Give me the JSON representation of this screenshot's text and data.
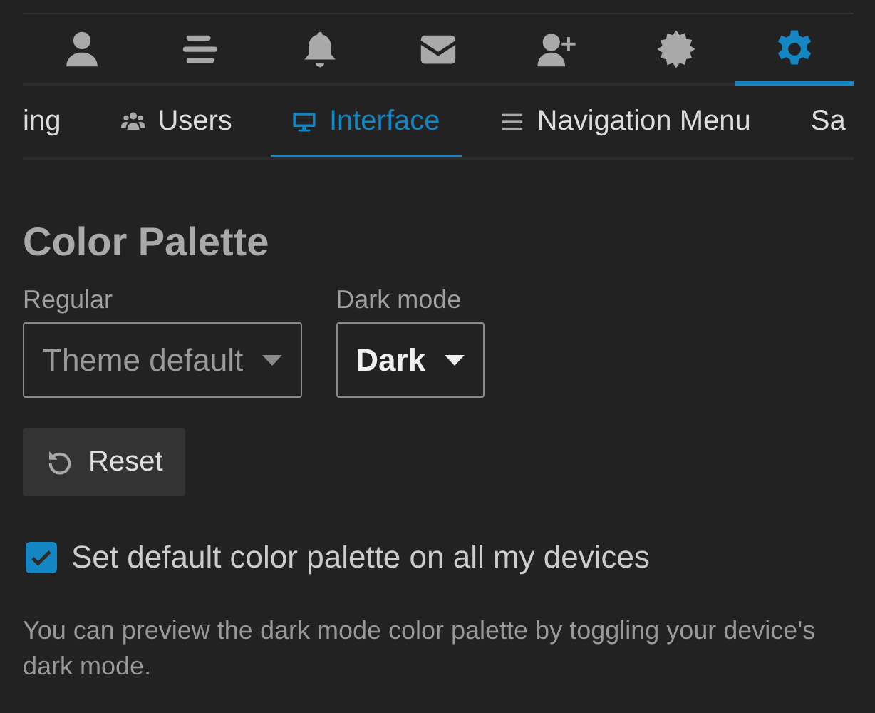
{
  "icon_tabs": [
    {
      "kind": "person",
      "selected": false
    },
    {
      "kind": "lines",
      "selected": false
    },
    {
      "kind": "bell",
      "selected": false
    },
    {
      "kind": "envelope",
      "selected": false
    },
    {
      "kind": "person-plus",
      "selected": false
    },
    {
      "kind": "badge",
      "selected": false
    },
    {
      "kind": "gear",
      "selected": true
    }
  ],
  "sub_tabs": [
    {
      "label": "ing",
      "selected": false
    },
    {
      "kind": "users",
      "label": "Users",
      "selected": false
    },
    {
      "kind": "monitor",
      "label": "Interface",
      "selected": true
    },
    {
      "kind": "menu",
      "label": "Navigation Menu",
      "selected": false
    },
    {
      "label": "Sa",
      "selected": false
    }
  ],
  "section": {
    "title": "Color Palette",
    "selects": [
      {
        "label": "Regular",
        "value": "Theme default",
        "default": true
      },
      {
        "label": "Dark mode",
        "value": "Dark",
        "default": false
      }
    ],
    "reset_button": "Reset",
    "checkbox": {
      "label": "Set default color palette on all my devices",
      "checked": true
    },
    "note": "You can preview the dark mode color palette by toggling your device's dark mode."
  }
}
